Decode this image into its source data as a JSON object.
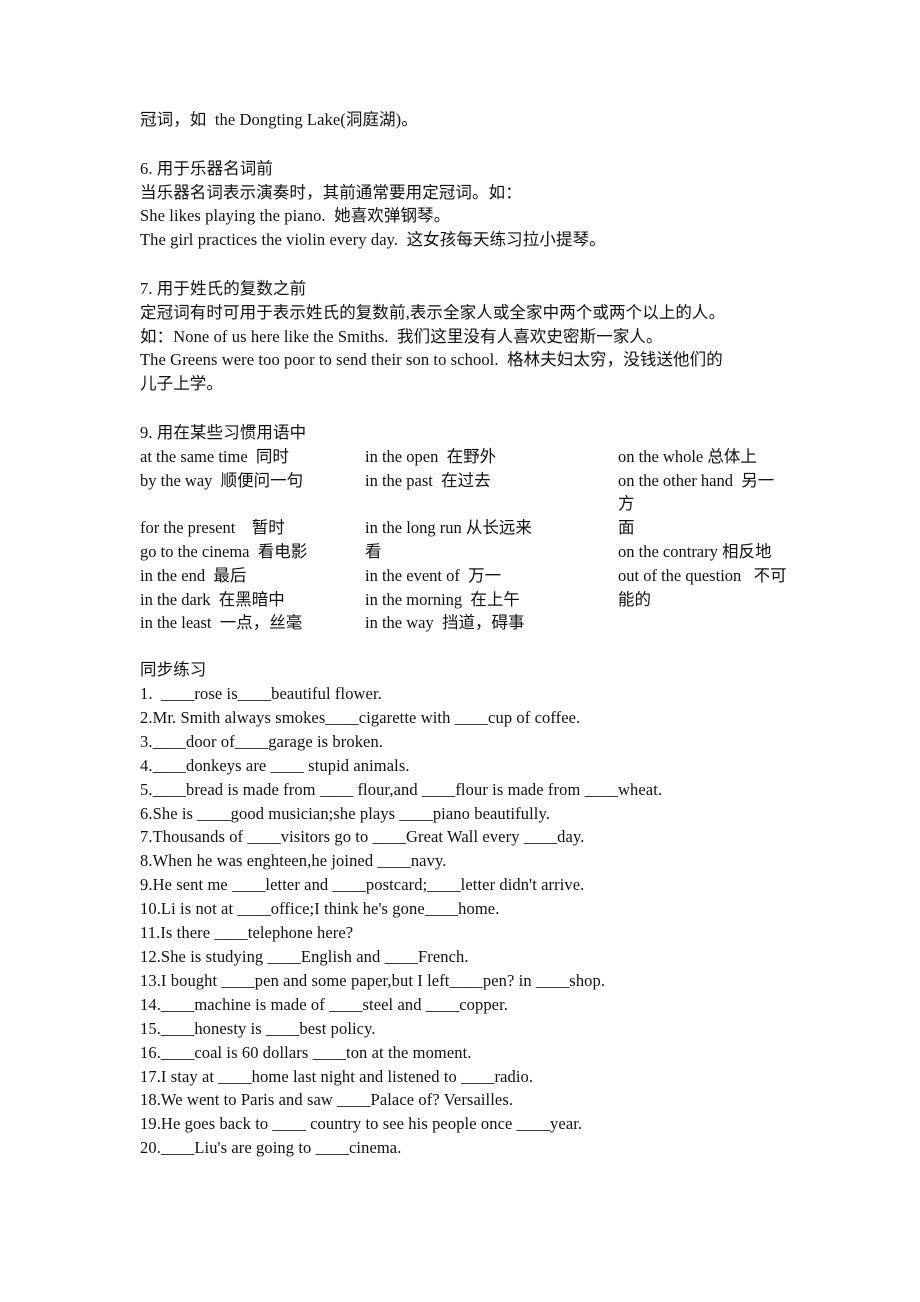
{
  "document": {
    "intro_line": "冠词，如  the Dongting Lake(洞庭湖)。",
    "sections": [
      {
        "heading": "6. 用于乐器名词前",
        "lines": [
          "当乐器名词表示演奏时，其前通常要用定冠词。如：",
          "She likes playing the piano.  她喜欢弹钢琴。",
          "The girl practices the violin every day.  这女孩每天练习拉小提琴。"
        ]
      },
      {
        "heading": "7. 用于姓氏的复数之前",
        "lines": [
          "定冠词有时可用于表示姓氏的复数前,表示全家人或全家中两个或两个以上的人。",
          "如：None of us here like the Smiths.  我们这里没有人喜欢史密斯一家人。",
          "The Greens were too poor to send their son to school.  格林夫妇太穷，没钱送他们的",
          "儿子上学。"
        ]
      }
    ],
    "idiom_section": {
      "heading": "9. 用在某些习惯用语中",
      "column1": [
        "at the same time  同时",
        "by the way  顺便问一句",
        "for the present    暂时",
        "go to the cinema  看电影",
        "in the end  最后",
        "in the dark  在黑暗中",
        "in the least  一点，丝毫"
      ],
      "column2": [
        "in the open  在野外",
        "in the past  在过去",
        "in the long run 从长远来",
        "看",
        "in the event of  万一",
        "in the morning  在上午",
        "in the way  挡道，碍事"
      ],
      "column3": [
        "on the whole 总体上",
        "on the other hand  另一方",
        "面",
        "on the contrary 相反地",
        "out of the question   不可",
        "能的",
        ""
      ]
    },
    "exercise_section": {
      "heading": "同步练习",
      "items": [
        "1.  ____rose is____beautiful flower.",
        "2.Mr. Smith always smokes____cigarette with ____cup of coffee.",
        "3.____door of____garage is broken.",
        "4.____donkeys are ____ stupid animals.",
        "5.____bread is made from ____ flour,and ____flour is made from ____wheat.",
        "6.She is ____good musician;she plays ____piano beautifully.",
        "7.Thousands of ____visitors go to ____Great Wall every ____day.",
        "8.When he was enghteen,he joined ____navy.",
        "9.He sent me ____letter and ____postcard;____letter didn't arrive.",
        "10.Li is not at ____office;I think he's gone____home.",
        "11.Is there ____telephone here?",
        "12.She is studying ____English and ____French.",
        "13.I bought ____pen and some paper,but I left____pen? in ____shop.",
        "14.____machine is made of ____steel and ____copper.",
        "15.____honesty is ____best policy.",
        "16.____coal is 60 dollars ____ton at the moment.",
        "17.I stay at ____home last night and listened to ____radio.",
        "18.We went to Paris and saw ____Palace of? Versailles.",
        "19.He goes back to ____ country to see his people once ____year.",
        "20.____Liu's are going to ____cinema."
      ]
    }
  }
}
